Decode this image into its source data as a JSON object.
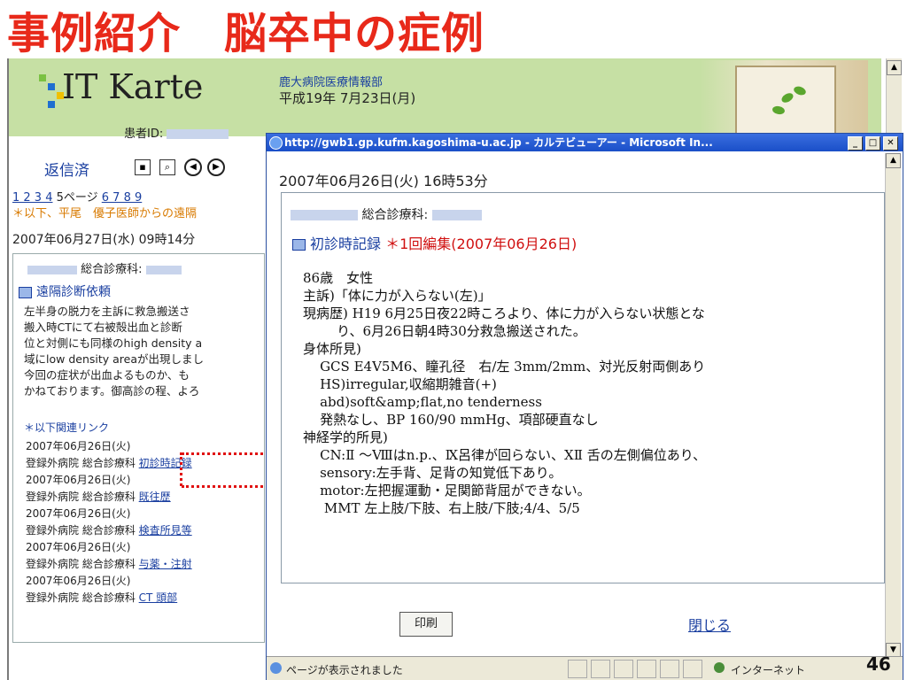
{
  "slide": {
    "title": "事例紹介　脳卒中の症例",
    "page_number": "46"
  },
  "background_app": {
    "logo_text": "IT Karte",
    "patient_label": "患者ID:",
    "department": "鹿大病院医療情報部",
    "date": "平成19年 7月23日(月)",
    "reply_status": "返信済",
    "pages_prefix": "1 2 3 4",
    "pages_current": " 5ページ ",
    "pages_suffix": "6 7 8 9",
    "remote_line": "＊以下、平尾　優子医師からの遠隔",
    "timestamp": "2007年06月27日(水) 09時14分",
    "card": {
      "dept": "総合診療科:",
      "request_title": "遠隔診断依頼",
      "body_lines": [
        "左半身の脱力を主訴に救急搬送さ",
        "搬入時CTにて右被殻出血と診断",
        "位と対側にも同様のhigh density a",
        "域にlow density areaが出現しまし",
        "今回の症状が出血よるものか、も",
        "かねております。御高診の程、よろ"
      ],
      "related_label": "＊以下関連リンク",
      "related": [
        {
          "date": "2007年06月26日(火)",
          "org": "登録外病院 総合診療科",
          "link": "初診時記録"
        },
        {
          "date": "2007年06月26日(火)",
          "org": "登録外病院 総合診療科",
          "link": "既往歴"
        },
        {
          "date": "2007年06月26日(火)",
          "org": "登録外病院 総合診療科",
          "link": "検査所見等"
        },
        {
          "date": "2007年06月26日(火)",
          "org": "登録外病院 総合診療科",
          "link": "与薬・注射"
        },
        {
          "date": "2007年06月26日(火)",
          "org": "登録外病院 総合診療科",
          "link": "CT 頭部"
        }
      ]
    }
  },
  "popup": {
    "title": "http://gwb1.gp.kufm.kagoshima-u.ac.jp - カルテビューアー - Microsoft In...",
    "timestamp": "2007年06月26日(火) 16時53分",
    "dept": "総合診療科:",
    "record_title": "初診時記録",
    "edit_note": "＊1回編集(2007年06月26日)",
    "record_lines": [
      "86歳　女性",
      "主訴)「体に力が入らない(左)」",
      "現病歴) H19 6月25日夜22時ころより、体に力が入らない状態とな",
      "        り、6月26日朝4時30分救急搬送された。",
      "身体所見)",
      "    GCS E4V5M6、瞳孔径　右/左 3mm/2mm、対光反射両側あり",
      "    HS)irregular,収縮期雑音(+)",
      "    abd)soft&amp;flat,no tenderness",
      "    発熱なし、BP 160/90 mmHg、項部硬直なし",
      "神経学的所見)",
      "    CN:Ⅱ ～Ⅷはn.p.、Ⅸ呂律が回らない、ⅩⅡ 舌の左側偏位あり、",
      "    sensory:左手背、足背の知覚低下あり。",
      "    motor:左把握運動・足関節背屈ができない。",
      "     MMT 左上肢/下肢、右上肢/下肢;4/4、5/5"
    ],
    "print_label": "印刷",
    "close_label": "閉じる",
    "status_text": "ページが表示されました",
    "zone_text": "インターネット"
  }
}
